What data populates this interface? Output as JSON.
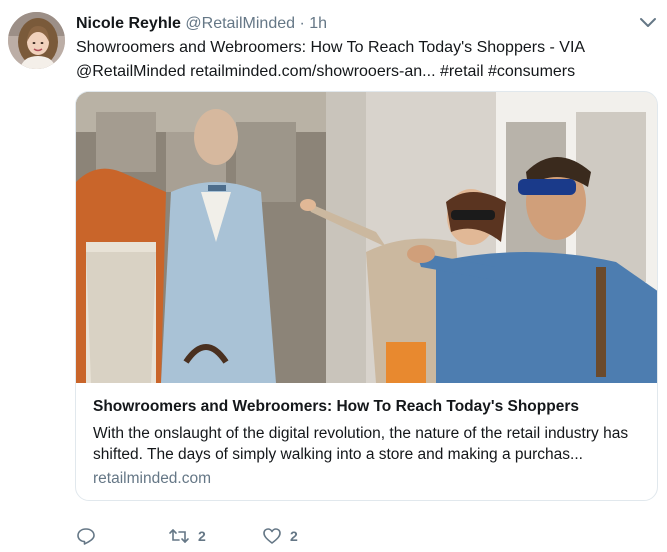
{
  "tweet": {
    "author_name": "Nicole Reyhle",
    "handle": "@RetailMinded",
    "separator": "·",
    "time": "1h",
    "text_line1": "Showroomers and Webroomers: How To Reach Today's Shoppers -  VIA",
    "text_line2": "@RetailMinded retailminded.com/showrooers-an... #retail #consumers",
    "avatar_icon": "user-avatar-photo",
    "menu_icon": "chevron-down-icon"
  },
  "card": {
    "image_icon": "shoppers-window-photo",
    "title": "Showroomers and Webroomers: How To Reach Today's Shoppers",
    "description": "With the onslaught of the digital revolution, the nature of the retail industry has shifted. The days of simply walking into a store and making a purchas...",
    "domain": "retailminded.com"
  },
  "actions": {
    "reply_icon": "reply-icon",
    "retweet_icon": "retweet-icon",
    "retweet_count": "2",
    "like_icon": "heart-icon",
    "like_count": "2"
  },
  "colors": {
    "text": "#14171a",
    "secondary": "#657786",
    "border": "#e1e8ed"
  }
}
